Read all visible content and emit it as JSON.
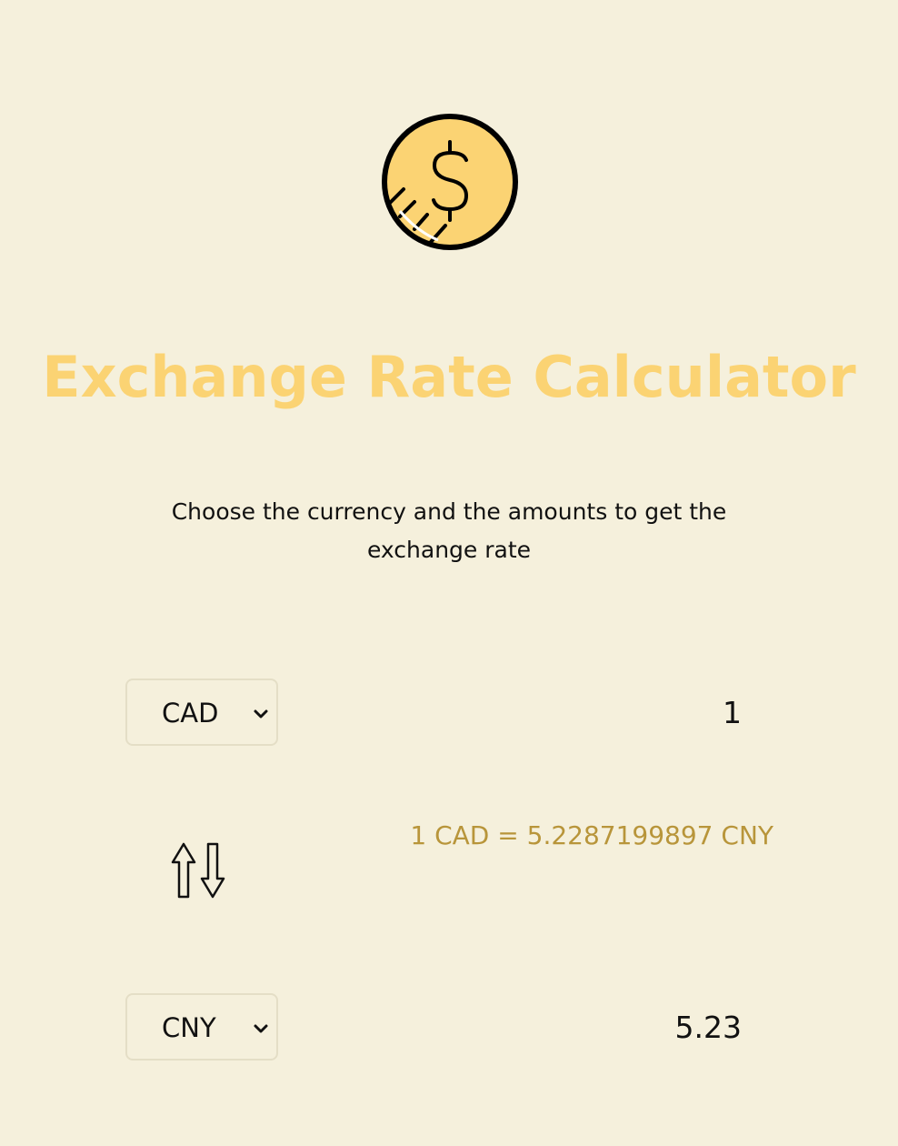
{
  "logo": {
    "icon": "dollar-coin-icon"
  },
  "header": {
    "title": "Exchange Rate Calculator",
    "subtitle": "Choose the currency and the amounts to get the exchange rate"
  },
  "currency_one": {
    "selected": "CAD",
    "amount": "1"
  },
  "swap": {
    "icon": "swap-arrows-icon"
  },
  "rate": {
    "text": "1 CAD = 5.2287199897 CNY"
  },
  "currency_two": {
    "selected": "CNY",
    "amount": "5.23"
  },
  "colors": {
    "background": "#f5f0dc",
    "accent": "#fbd373",
    "rate_text": "#b8953a"
  }
}
